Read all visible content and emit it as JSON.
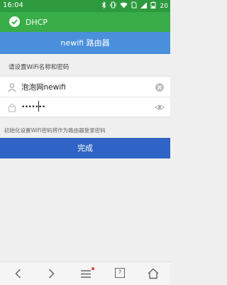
{
  "status_bar": {
    "time": "16:04",
    "battery_text": "20",
    "icons": [
      "bluetooth-icon",
      "vibrate-icon",
      "wifi-icon",
      "sim-icon",
      "signal-icon",
      "battery-icon"
    ]
  },
  "connection": {
    "label": "DHCP",
    "status_icon": "check-circle-icon",
    "bar_color": "#38ad48"
  },
  "header": {
    "title": "newifi 路由器",
    "bar_color": "#4a8fdc"
  },
  "form": {
    "section_label": "请设置WiFi名称和密码",
    "ssid": {
      "icon": "user-icon",
      "value": "泡泡网newifi",
      "clear_icon": "clear-icon"
    },
    "password": {
      "icon": "lock-icon",
      "masked_value": "•••••••",
      "toggle_icon": "eye-icon"
    }
  },
  "hint": "初始化设置WiFi密码将作为路由器登录密码",
  "submit": {
    "label": "完成",
    "color": "#2f64c6"
  },
  "nav_bar": {
    "tab_count": "7",
    "items": [
      "back-icon",
      "forward-icon",
      "menu-icon",
      "tabs-icon",
      "home-icon"
    ]
  }
}
